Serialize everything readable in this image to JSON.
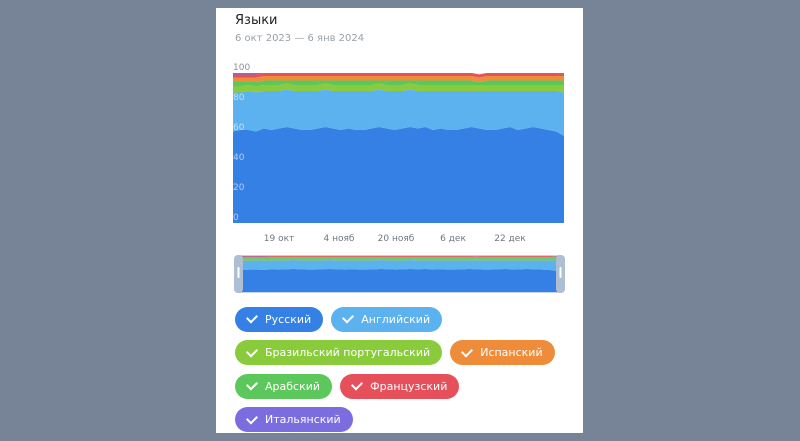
{
  "card": {
    "title": "Языки",
    "subtitle": "6 окт 2023 — 6 янв 2024"
  },
  "chart_data": {
    "type": "area",
    "stacked": true,
    "ylim": [
      0,
      100
    ],
    "yticks": [
      "0",
      "20",
      "40",
      "60",
      "80",
      "100"
    ],
    "xticks": [
      "19 окт",
      "4 нояб",
      "20 нояб",
      "6 дек",
      "22 дек"
    ],
    "series": [
      {
        "name": "Русский",
        "color": "#3580e4",
        "values": [
          61,
          62,
          62,
          61,
          63,
          62,
          63,
          64,
          63,
          62,
          62,
          63,
          64,
          63,
          62,
          63,
          62,
          62,
          63,
          64,
          63,
          62,
          63,
          64,
          63,
          64,
          62,
          63,
          62,
          62,
          63,
          64,
          63,
          62,
          62,
          63,
          64,
          62,
          63,
          64,
          63,
          62,
          61,
          58
        ]
      },
      {
        "name": "Английский",
        "color": "#5cb1ef",
        "values": [
          26,
          25,
          26,
          26,
          25,
          26,
          25,
          25,
          25,
          26,
          26,
          25,
          25,
          25,
          26,
          25,
          26,
          26,
          25,
          25,
          25,
          26,
          25,
          25,
          25,
          24,
          26,
          25,
          26,
          26,
          25,
          24,
          25,
          26,
          26,
          25,
          24,
          26,
          25,
          24,
          25,
          26,
          27,
          29
        ]
      },
      {
        "name": "Бразильский португальский",
        "color": "#8acb3c",
        "values": [
          4,
          4,
          4,
          4,
          4,
          4,
          4,
          4,
          4,
          4,
          4,
          4,
          4,
          4,
          4,
          4,
          4,
          4,
          4,
          4,
          4,
          4,
          4,
          4,
          4,
          4,
          4,
          4,
          4,
          4,
          4,
          4,
          4,
          4,
          4,
          4,
          4,
          4,
          4,
          4,
          4,
          4,
          4,
          5
        ]
      },
      {
        "name": "Арабский",
        "color": "#5cc85c",
        "values": [
          3,
          3,
          2,
          3,
          3,
          3,
          3,
          2,
          3,
          3,
          3,
          3,
          2,
          3,
          3,
          3,
          3,
          3,
          3,
          2,
          3,
          3,
          3,
          2,
          3,
          3,
          3,
          3,
          3,
          3,
          3,
          3,
          2,
          3,
          3,
          3,
          3,
          3,
          3,
          3,
          3,
          3,
          3,
          3
        ]
      },
      {
        "name": "Испанский",
        "color": "#ef8c3a",
        "values": [
          3,
          3,
          3,
          3,
          3,
          3,
          3,
          3,
          3,
          3,
          3,
          3,
          3,
          3,
          3,
          3,
          3,
          3,
          3,
          3,
          3,
          3,
          3,
          3,
          3,
          3,
          3,
          3,
          3,
          3,
          3,
          3,
          3,
          3,
          3,
          3,
          3,
          3,
          3,
          3,
          3,
          3,
          3,
          3
        ]
      },
      {
        "name": "Французский",
        "color": "#e5505a",
        "values": [
          2,
          2,
          2,
          2,
          2,
          2,
          2,
          2,
          2,
          2,
          2,
          2,
          2,
          2,
          2,
          2,
          2,
          2,
          2,
          2,
          2,
          2,
          2,
          2,
          2,
          2,
          2,
          2,
          2,
          2,
          2,
          2,
          2,
          2,
          2,
          2,
          2,
          2,
          2,
          2,
          2,
          2,
          2,
          1
        ]
      },
      {
        "name": "Итальянский",
        "color": "#7b6ce0",
        "values": [
          1,
          1,
          1,
          1,
          0,
          0,
          0,
          0,
          0,
          0,
          0,
          0,
          0,
          0,
          0,
          0,
          0,
          0,
          0,
          0,
          0,
          0,
          0,
          0,
          0,
          0,
          0,
          0,
          0,
          0,
          0,
          0,
          0,
          0,
          0,
          0,
          0,
          0,
          0,
          0,
          0,
          0,
          0,
          1
        ]
      }
    ]
  },
  "legend": [
    {
      "label": "Русский",
      "color": "#3580e4"
    },
    {
      "label": "Английский",
      "color": "#5cb1ef"
    },
    {
      "label": "Бразильский португальский",
      "color": "#8acb3c"
    },
    {
      "label": "Испанский",
      "color": "#ef8c3a"
    },
    {
      "label": "Арабский",
      "color": "#5cc85c"
    },
    {
      "label": "Французский",
      "color": "#e5505a"
    },
    {
      "label": "Итальянский",
      "color": "#7b6ce0"
    }
  ]
}
